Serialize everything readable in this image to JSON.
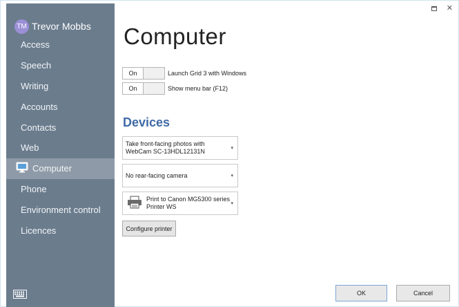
{
  "sidebar": {
    "user": {
      "initials": "TM",
      "name": "Trevor Mobbs"
    },
    "items": [
      {
        "label": "Access"
      },
      {
        "label": "Speech"
      },
      {
        "label": "Writing"
      },
      {
        "label": "Accounts"
      },
      {
        "label": "Contacts"
      },
      {
        "label": "Web"
      },
      {
        "label": "Computer",
        "active": true,
        "icon": "monitor-icon"
      },
      {
        "label": "Phone"
      },
      {
        "label": "Environment control"
      },
      {
        "label": "Licences"
      }
    ],
    "keyboard_icon": "keyboard-icon"
  },
  "main": {
    "title": "Computer",
    "toggles": [
      {
        "state": "On",
        "label": "Launch Grid 3 with Windows"
      },
      {
        "state": "On",
        "label": "Show menu bar (F12)"
      }
    ],
    "devices": {
      "title": "Devices",
      "front_camera": "Take front-facing photos with WebCam SC-13HDL12131N",
      "rear_camera": "No rear-facing camera",
      "printer": "Print to Canon MG5300 series Printer WS",
      "configure_label": "Configure printer"
    }
  },
  "footer": {
    "ok_label": "OK",
    "cancel_label": "Cancel"
  },
  "colors": {
    "sidebar": "#6b7c8d",
    "active_item": "#8e9aa7",
    "accent": "#3f6aa6"
  }
}
